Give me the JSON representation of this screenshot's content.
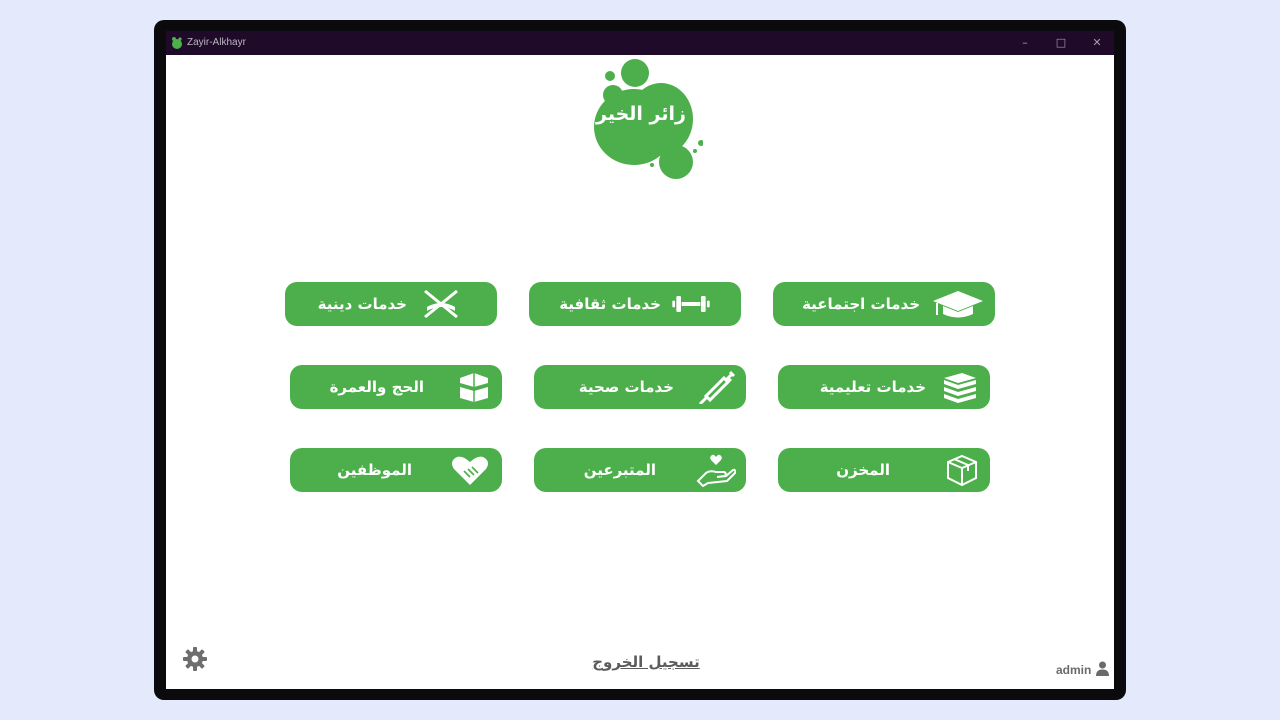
{
  "window": {
    "title": "Zayir-Alkhayr",
    "minimize": "–",
    "maximize": "□",
    "close": "✕"
  },
  "logo": {
    "text": "زائر الخير",
    "color": "#4caf4b"
  },
  "services": [
    {
      "label": "خدمات دينية",
      "icon": "quran-icon"
    },
    {
      "label": "خدمات ثقافية",
      "icon": "dumbbell-icon"
    },
    {
      "label": "خدمات اجتماعية",
      "icon": "graduation-cap-icon"
    },
    {
      "label": "الحج والعمرة",
      "icon": "kaaba-icon"
    },
    {
      "label": "خدمات صحية",
      "icon": "syringe-icon"
    },
    {
      "label": "خدمات تعليمية",
      "icon": "books-icon"
    },
    {
      "label": "الموظفين",
      "icon": "handshake-heart-icon"
    },
    {
      "label": "المتبرعين",
      "icon": "hand-heart-icon"
    },
    {
      "label": "المخزن",
      "icon": "box-icon"
    }
  ],
  "footer": {
    "logout": "تسجيل الخروج",
    "user": "admin"
  },
  "colors": {
    "accent": "#4caf4b",
    "titlebar": "#1f0a2a"
  }
}
